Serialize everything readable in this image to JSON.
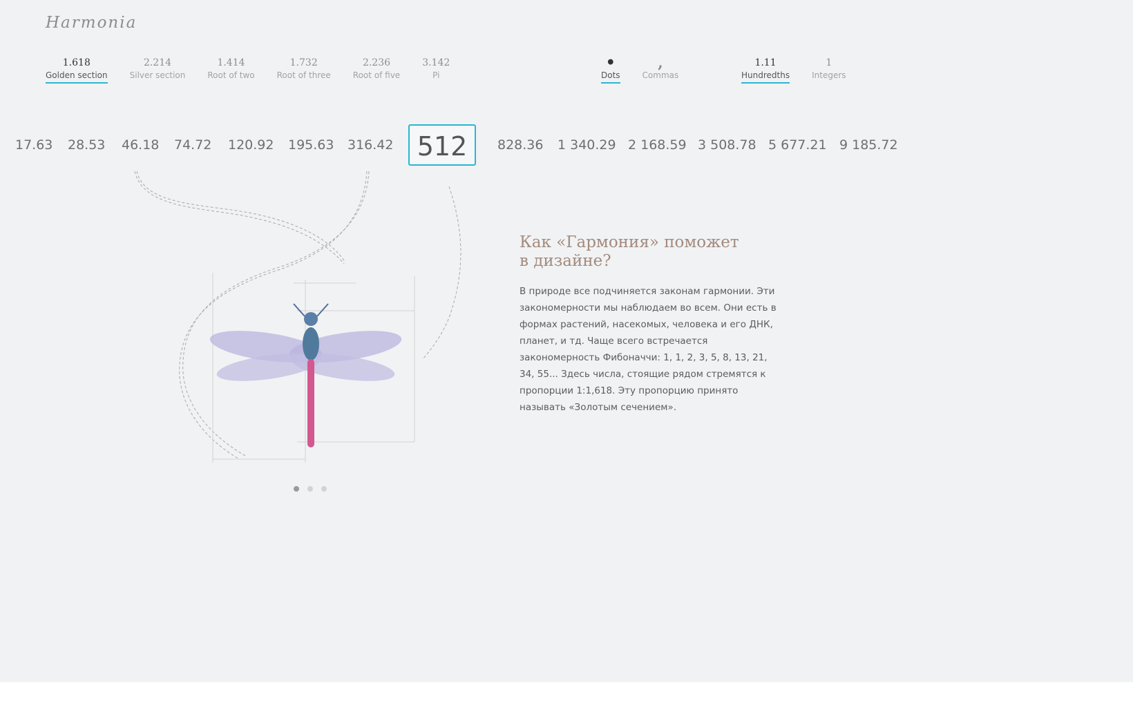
{
  "brand": {
    "logo": "Harmonia"
  },
  "ratios": [
    {
      "value": "1.618",
      "label": "Golden section",
      "active": true
    },
    {
      "value": "2.214",
      "label": "Silver section",
      "active": false
    },
    {
      "value": "1.414",
      "label": "Root of two",
      "active": false
    },
    {
      "value": "1.732",
      "label": "Root of three",
      "active": false
    },
    {
      "value": "2.236",
      "label": "Root of five",
      "active": false
    },
    {
      "value": "3.142",
      "label": "Pi",
      "active": false
    }
  ],
  "separators": [
    {
      "value": "•",
      "label": "Dots",
      "active": true
    },
    {
      "value": ",",
      "label": "Commas",
      "active": false
    }
  ],
  "precision": [
    {
      "value": "1.11",
      "label": "Hundredths",
      "active": true
    },
    {
      "value": "1",
      "label": "Integers",
      "active": false
    }
  ],
  "scale": {
    "values": [
      "17.63",
      "28.53",
      "46.18",
      "74.72",
      "120.92",
      "195.63",
      "316.42",
      "512",
      "828.36",
      "1 340.29",
      "2 168.59",
      "3 508.78",
      "5 677.21",
      "9 185.72"
    ],
    "base": "512"
  },
  "info": {
    "title_line1": "Как «Гармония» поможет",
    "title_line2": "в дизайне?",
    "paragraph": "В природе все подчиняется законам гармонии. Эти закономерности мы наблюдаем во всем. Они есть в формах растений, насекомых, человека и его ДНК, планет, и тд. Чаще всего встречается закономерность Фибоначчи: 1, 1, 2, 3, 5, 8, 13, 21, 34, 55... Здесь числа, стоящие рядом стремятся к пропорции 1:1,618. Эту пропорцию принято называть «Золотым сечением»."
  },
  "slider": {
    "count": 3,
    "active_index": 0
  },
  "colors": {
    "accent": "#29b6d1",
    "background": "#f1f2f4",
    "title": "#a38a7d"
  },
  "icons": {
    "illustration": "dragonfly-icon"
  }
}
